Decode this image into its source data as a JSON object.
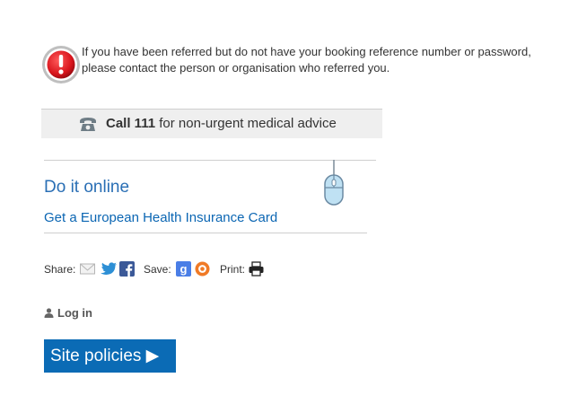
{
  "notice": {
    "icon": "alert-icon",
    "text": "If you have been referred but do not have your booking reference number or password, please contact the person or organisation who referred you."
  },
  "call": {
    "icon": "phone-icon",
    "bold": "Call 111",
    "rest": " for non-urgent medical advice"
  },
  "online": {
    "title": "Do it online",
    "link": "Get a European Health Insurance Card",
    "icon": "mouse-icon"
  },
  "share": {
    "share_label": "Share:",
    "save_label": "Save:",
    "print_label": "Print:",
    "icons": [
      "email-icon",
      "twitter-icon",
      "facebook-icon",
      "google-icon",
      "delicious-icon",
      "printer-icon"
    ]
  },
  "login": {
    "label": "Log in",
    "icon": "user-icon"
  },
  "policies": {
    "label": "Site policies ▶"
  },
  "colors": {
    "link": "#0b66b3",
    "button": "#0b6bb5",
    "alert": "#d8141c"
  }
}
